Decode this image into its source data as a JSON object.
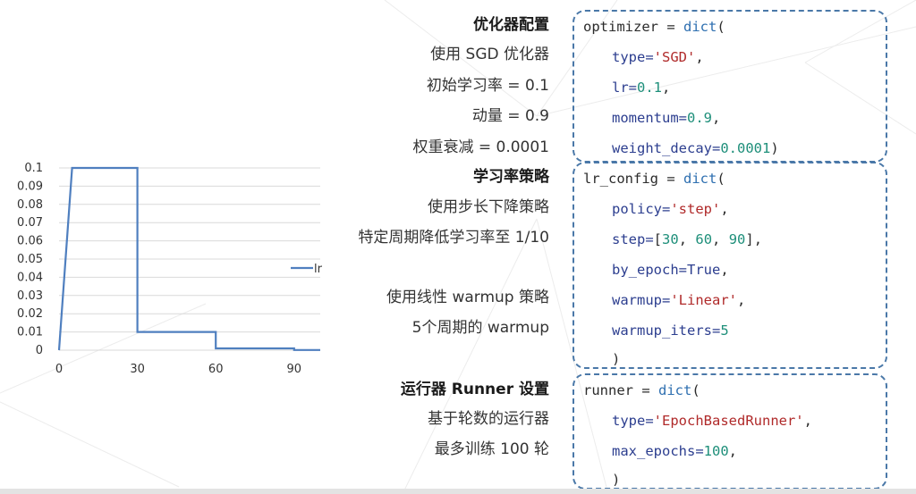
{
  "labels": {
    "optimizer_header": "优化器配置",
    "use_sgd": "使用 SGD 优化器",
    "initial_lr": "初始学习率 = 0.1",
    "momentum": "动量 = 0.9",
    "weight_decay": "权重衰减 = 0.0001",
    "lr_header": "学习率策略",
    "step_policy": "使用步长下降策略",
    "step_desc": "特定周期降低学习率至 1/10",
    "linear_warmup": "使用线性 warmup 策略",
    "warmup_iters": "5个周期的 warmup",
    "runner_header": "运行器 Runner 设置",
    "epoch_runner": "基于轮数的运行器",
    "max_epochs": "最多训练 100 轮"
  },
  "code": {
    "optimizer": {
      "var": "optimizer",
      "eq": " = ",
      "fn": "dict",
      "paren_open": "(",
      "type_key": "type=",
      "type_val": "'SGD'",
      "lr_key": "lr=",
      "lr_val": "0.1",
      "momentum_key": "momentum=",
      "momentum_val": "0.9",
      "wd_key": "weight_decay=",
      "wd_val": "0.0001",
      "close": ")",
      "comma": ","
    },
    "lr_config": {
      "var": "lr_config",
      "eq": " = ",
      "fn": "dict",
      "paren_open": "(",
      "policy_key": "policy=",
      "policy_val": "'step'",
      "step_key": "step=",
      "step_open": "[",
      "step_v1": "30",
      "step_v2": "60",
      "step_v3": "90",
      "step_close": "]",
      "sep": ", ",
      "by_epoch_key": "by_epoch=",
      "by_epoch_val": "True",
      "warmup_key": "warmup=",
      "warmup_val": "'Linear'",
      "warmup_iters_key": "warmup_iters=",
      "warmup_iters_val": "5",
      "close": ")",
      "comma": ","
    },
    "runner": {
      "var": "runner",
      "eq": " = ",
      "fn": "dict",
      "paren_open": "(",
      "type_key": "type=",
      "type_val": "'EpochBasedRunner'",
      "max_epochs_key": "max_epochs=",
      "max_epochs_val": "100",
      "close": ")",
      "comma": ","
    }
  },
  "colors": {
    "code_keyword": "#2c3e8f",
    "code_string": "#b02a2a",
    "code_number": "#1e8f7a",
    "box_border": "#4a78a8",
    "series_line": "#4f7fbf"
  },
  "chart_data": {
    "type": "line",
    "title": "",
    "xlabel": "",
    "ylabel": "",
    "xlim": [
      0,
      100
    ],
    "ylim": [
      0,
      0.1
    ],
    "x_ticks": [
      "0",
      "30",
      "60",
      "90"
    ],
    "y_ticks": [
      "0",
      "0.01",
      "0.02",
      "0.03",
      "0.04",
      "0.05",
      "0.06",
      "0.07",
      "0.08",
      "0.09",
      "0.1"
    ],
    "grid": true,
    "legend": "right",
    "series": [
      {
        "name": "lr",
        "x": [
          0,
          5,
          30,
          30,
          60,
          60,
          90,
          90,
          100
        ],
        "y": [
          0,
          0.1,
          0.1,
          0.01,
          0.01,
          0.001,
          0.001,
          0.0001,
          0.0001
        ]
      }
    ]
  }
}
